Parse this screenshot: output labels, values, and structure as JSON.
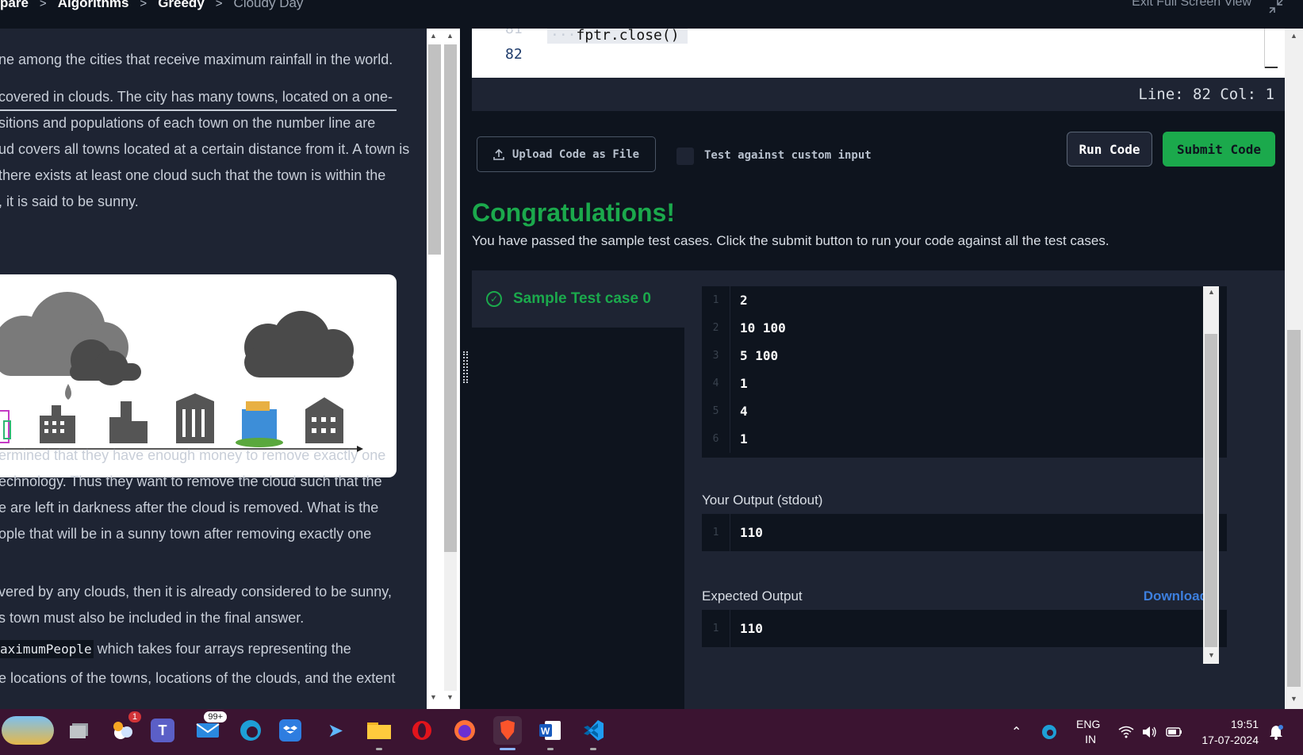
{
  "breadcrumb": {
    "items": [
      "pare",
      "Algorithms",
      "Greedy"
    ],
    "current": "Cloudy Day"
  },
  "exit_fullscreen": "Exit Full Screen View",
  "problem": {
    "line1": "ne among the cities that receive maximum rainfall in the world.",
    "para1": [
      " covered in clouds. The city has many towns, located on a one-",
      "sitions and populations of each town on the number line are",
      "ud covers all towns located at a certain distance from it. A town is",
      "there exists at least one cloud such that the town is within the",
      ", it is said to be sunny."
    ],
    "para2": [
      "ermined that they have enough money to remove exactly one",
      "echnology. Thus they want to remove the cloud such that the",
      "e are left in darkness after the cloud is removed. What is the",
      "ople that will be in a sunny town after removing exactly one"
    ],
    "para3": [
      "vered by any clouds, then it is already considered to be sunny,",
      "s town must also be included in the final answer."
    ],
    "func_name": "aximumPeople",
    "func_rest": " which takes four arrays representing the",
    "last_line": "e locations of the towns, locations of the clouds, and the extent"
  },
  "editor": {
    "partial_line_no": "81",
    "line_no": "82",
    "code_text": "fptr.close()",
    "status": "Line: 82 Col: 1"
  },
  "actions": {
    "upload_label": "Upload Code as File",
    "custom_input_label": "Test against custom input",
    "run_label": "Run Code",
    "submit_label": "Submit Code"
  },
  "result": {
    "title": "Congratulations!",
    "message": "You have passed the sample test cases. Click the submit button to run your code against all the test cases.",
    "test_case_label": "Sample Test case 0",
    "input_lines": [
      {
        "n": "1",
        "v": "2"
      },
      {
        "n": "2",
        "v": "10 100"
      },
      {
        "n": "3",
        "v": "5 100"
      },
      {
        "n": "4",
        "v": "1"
      },
      {
        "n": "5",
        "v": "4"
      },
      {
        "n": "6",
        "v": "1"
      }
    ],
    "your_output_label": "Your Output (stdout)",
    "your_output": {
      "n": "1",
      "v": "110"
    },
    "expected_label": "Expected Output",
    "download_label": "Download",
    "expected_output": {
      "n": "1",
      "v": "110"
    }
  },
  "taskbar": {
    "mail_badge": "99+",
    "weather_badge": "1",
    "lang_top": "ENG",
    "lang_bottom": "IN",
    "time": "19:51",
    "date": "17-07-2024"
  },
  "colors": {
    "accent_green": "#1ba94c",
    "link_blue": "#3d7fde",
    "bg_dark": "#0e141e",
    "panel": "#1e2433"
  }
}
